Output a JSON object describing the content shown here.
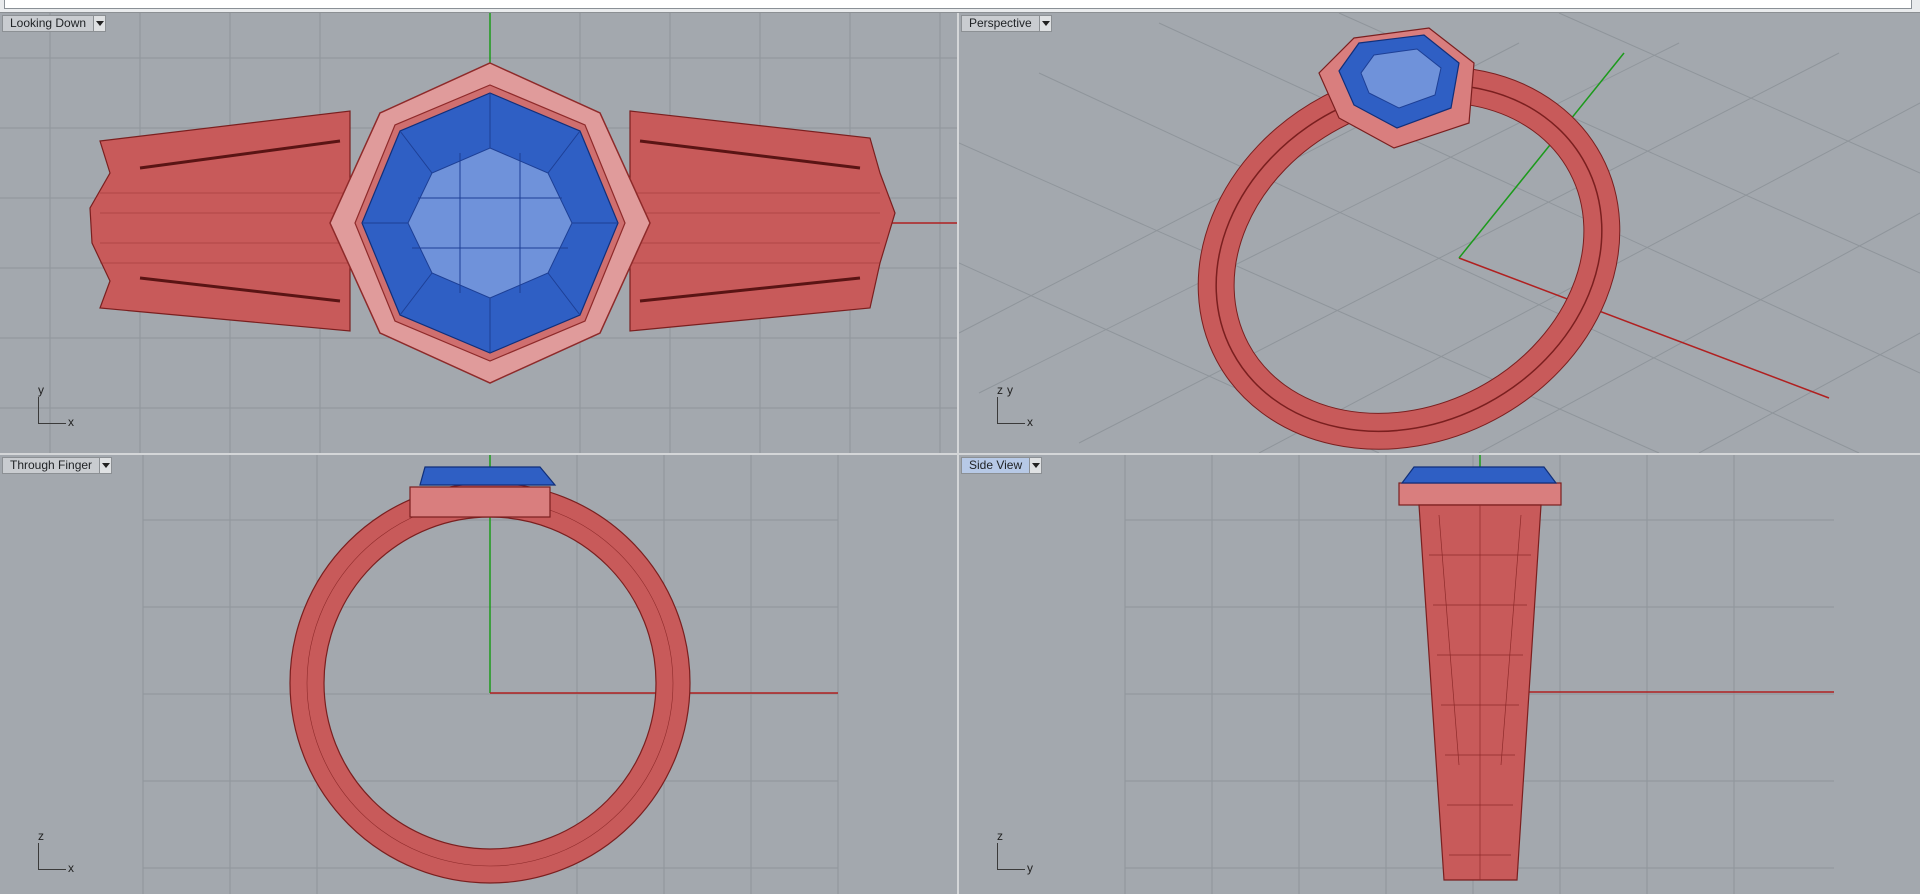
{
  "viewports": [
    {
      "id": "top",
      "label": "Looking Down",
      "active": false,
      "axis_v": "y",
      "axis_h": "x"
    },
    {
      "id": "persp",
      "label": "Perspective",
      "active": false,
      "axis_v": "z",
      "axis_v2": "y",
      "axis_h": "x"
    },
    {
      "id": "front",
      "label": "Through Finger",
      "active": false,
      "axis_v": "z",
      "axis_h": "x"
    },
    {
      "id": "side",
      "label": "Side View",
      "active": true,
      "axis_v": "z",
      "axis_h": "y"
    }
  ],
  "colors": {
    "viewport_bg": "#a3a8ae",
    "grid": "#8f959b",
    "x_axis": "#b02020",
    "y_axis": "#1c9a1c",
    "ring_metal": "#c85a5a",
    "ring_wire": "#7a1f1f",
    "stone": "#2f5fc4",
    "stone_light": "#6f92da"
  }
}
